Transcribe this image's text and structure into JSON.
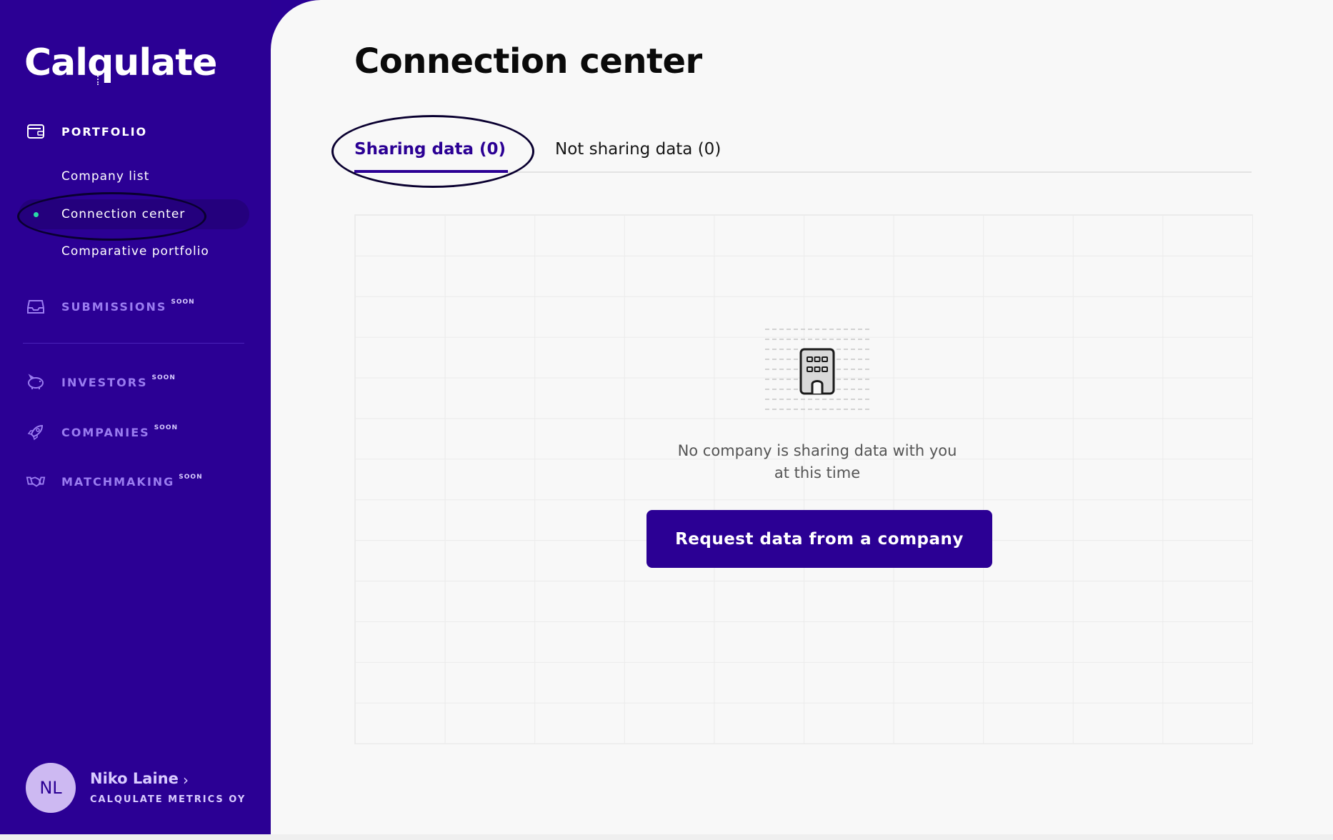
{
  "brand": {
    "name": "Calqulate"
  },
  "sidebar": {
    "portfolio": {
      "label": "PORTFOLIO",
      "icon": "wallet-icon",
      "items": [
        {
          "label": "Company list"
        },
        {
          "label": "Connection center",
          "active": true
        },
        {
          "label": "Comparative portfolio"
        }
      ]
    },
    "sections": [
      {
        "label": "SUBMISSIONS",
        "badge": "SOON",
        "icon": "inbox-icon"
      },
      {
        "label": "INVESTORS",
        "badge": "SOON",
        "icon": "piggy-bank-icon"
      },
      {
        "label": "COMPANIES",
        "badge": "SOON",
        "icon": "rocket-icon"
      },
      {
        "label": "MATCHMAKING",
        "badge": "SOON",
        "icon": "handshake-icon"
      }
    ],
    "user": {
      "initials": "NL",
      "name": "Niko Laine",
      "company": "CALQULATE METRICS OY"
    }
  },
  "main": {
    "title": "Connection center",
    "tabs": [
      {
        "label": "Sharing data (0)",
        "active": true
      },
      {
        "label": "Not sharing data (0)",
        "active": false
      }
    ],
    "empty_state": {
      "icon": "building-icon",
      "message_line1": "No company is sharing data with you",
      "message_line2": "at this time",
      "button_label": "Request data from a company"
    }
  },
  "colors": {
    "sidebar": "#2b0094",
    "accent": "#2b0094",
    "active_dot": "#29d9a7",
    "main_bg": "#f8f8f8"
  }
}
